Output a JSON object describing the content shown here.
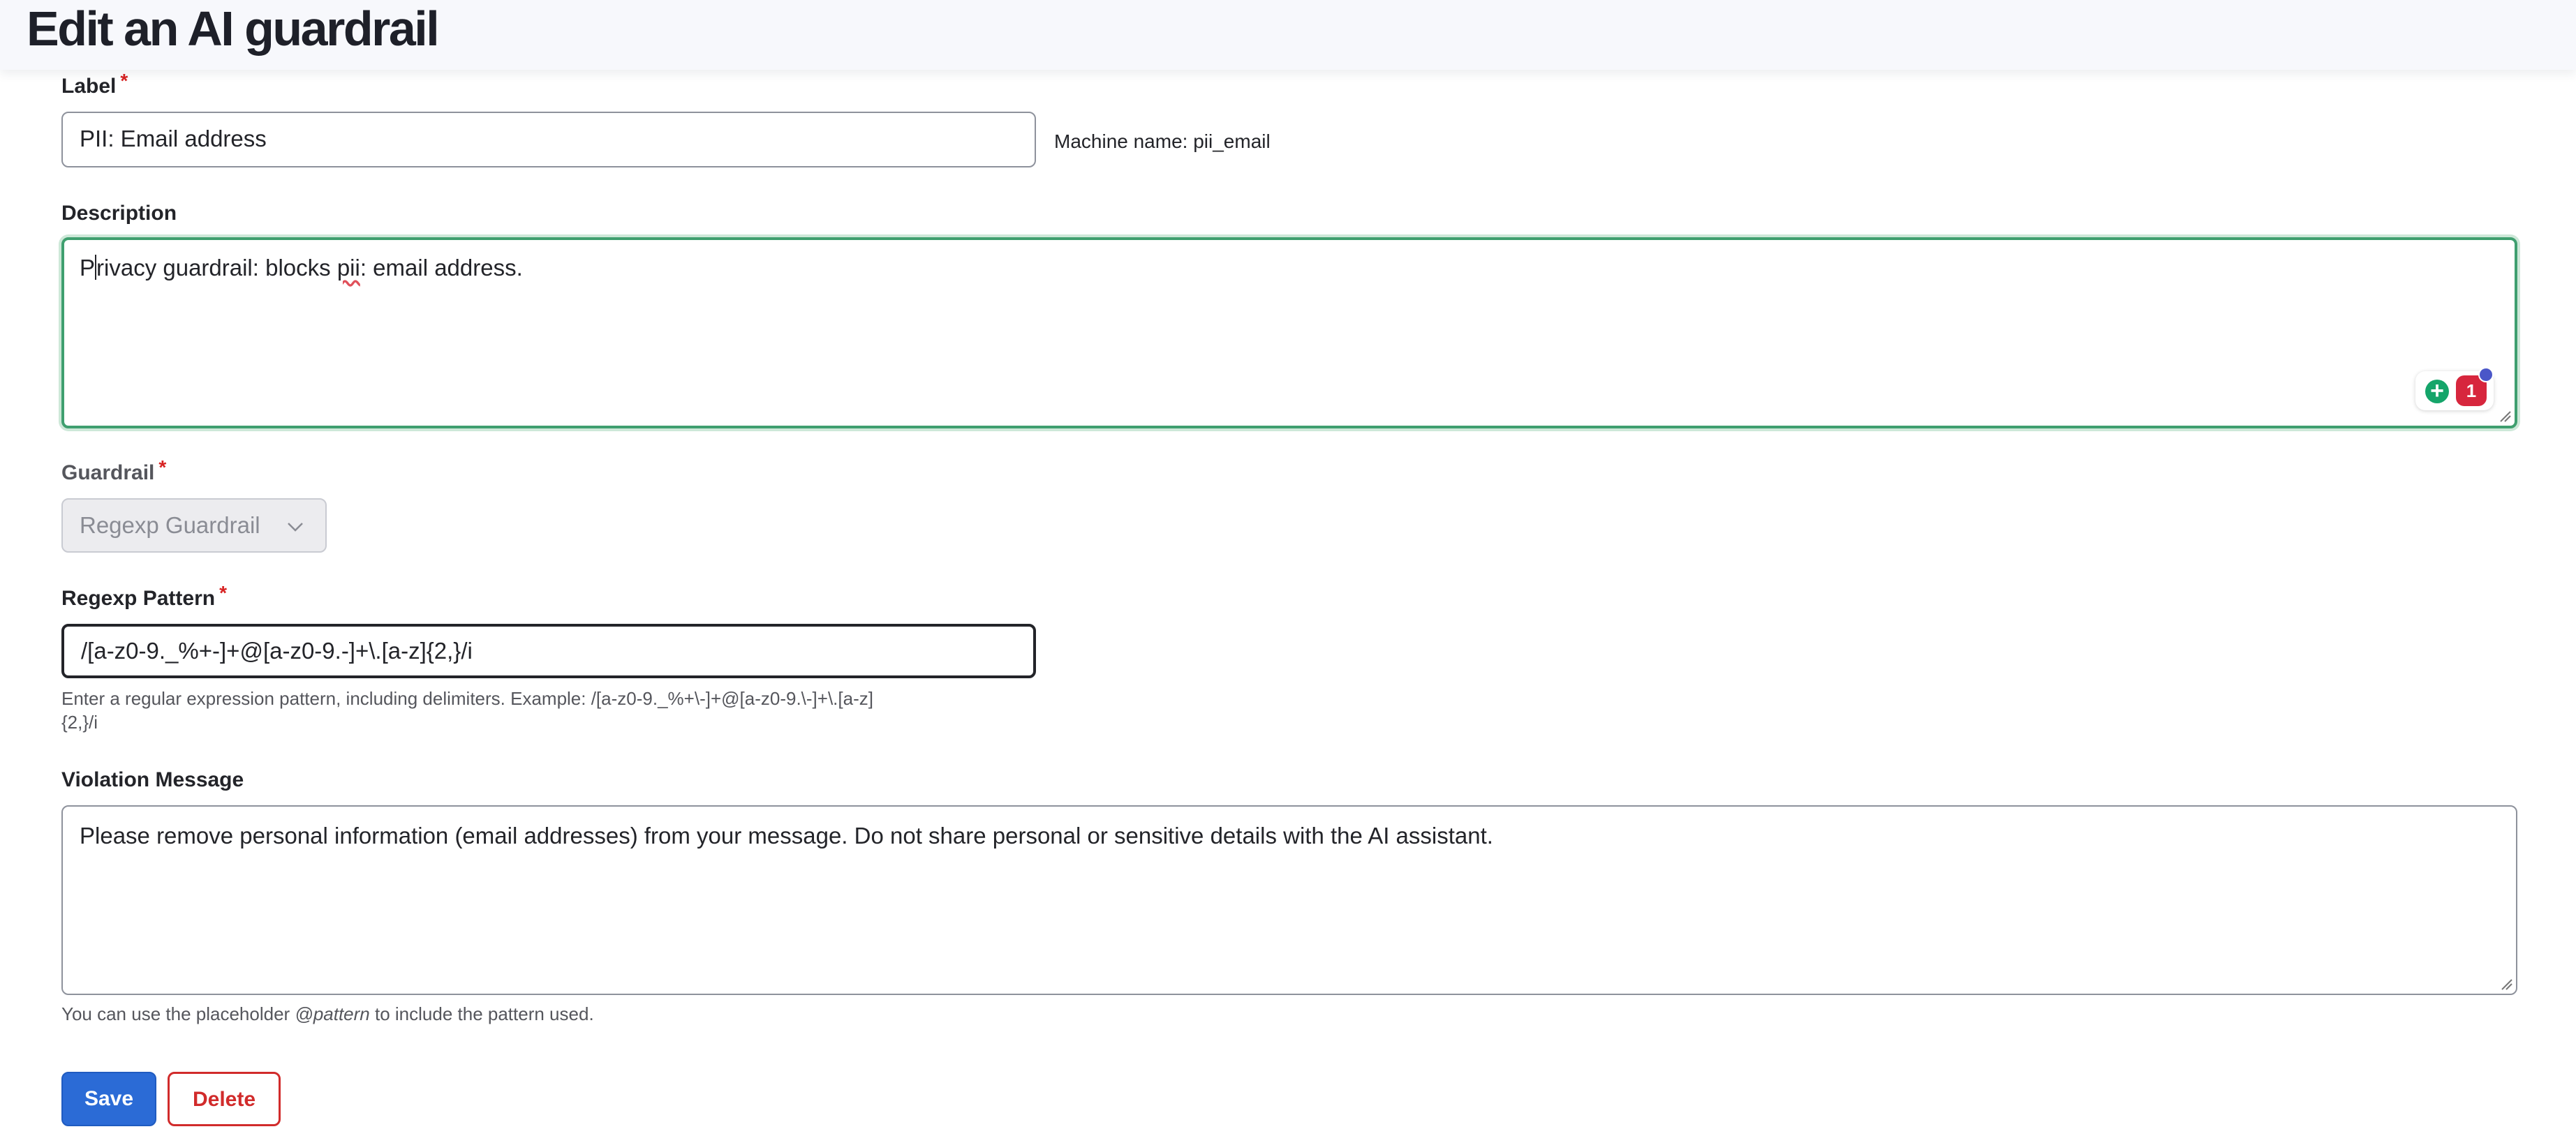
{
  "header": {
    "title": "Edit an AI guardrail"
  },
  "form": {
    "label": {
      "label": "Label",
      "required": "*",
      "value": "PII: Email address",
      "machine_name_prefix": "Machine name:",
      "machine_name": "pii_email"
    },
    "description": {
      "label": "Description",
      "value_first_char": "P",
      "value_part1": "rivacy guardrail: blocks ",
      "value_misspelled": "pii",
      "value_part2": ": email address."
    },
    "guardrail": {
      "label": "Guardrail",
      "required": "*",
      "selected": "Regexp Guardrail",
      "disabled": true
    },
    "regexp_pattern": {
      "label": "Regexp Pattern",
      "required": "*",
      "value": "/[a-z0-9._%+-]+@[a-z0-9.-]+\\.[a-z]{2,}/i",
      "help_line1": "Enter a regular expression pattern, including delimiters. Example: /[a-z0-9._%+\\-]+@[a-z0-9.\\-]+\\.[a-z]",
      "help_line2": "{2,}/i"
    },
    "violation_message": {
      "label": "Violation Message",
      "value": "Please remove personal information (email addresses) from your message. Do not share personal or sensitive details with the AI assistant.",
      "help_before": "You can use the placeholder",
      "help_placeholder": "@pattern",
      "help_after": "to include the pattern used."
    },
    "actions": {
      "save_label": "Save",
      "delete_label": "Delete"
    }
  },
  "extensions": {
    "grammar_icon": "grammarly-icon",
    "issues_count": "1",
    "accent_green": "#3f9f6f",
    "primary_blue": "#2b6bd6",
    "danger_red": "#d12b2b"
  }
}
